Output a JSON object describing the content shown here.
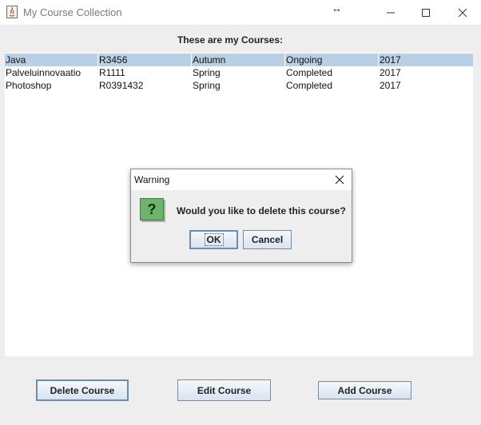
{
  "window": {
    "title": "My Course Collection",
    "cursor_glyph": "↔"
  },
  "heading": "These are my Courses:",
  "table": {
    "rows": [
      [
        "Java",
        "R3456",
        "Autumn",
        "Ongoing",
        "2017"
      ],
      [
        "Palveluinnovaatio",
        "R1111",
        "Spring",
        "Completed",
        "2017"
      ],
      [
        "Photoshop",
        "R0391432",
        "Spring",
        "Completed",
        "2017"
      ]
    ],
    "selected_row": 0
  },
  "dialog": {
    "title": "Warning",
    "message": "Would you like to delete this course?",
    "icon": "question-icon",
    "icon_glyph": "?",
    "ok_label": "OK",
    "cancel_label": "Cancel"
  },
  "buttons": {
    "delete": "Delete Course",
    "edit": "Edit Course",
    "add": "Add Course"
  },
  "colors": {
    "selection": "#b8cfe5",
    "dialog_icon": "#6db36d"
  }
}
